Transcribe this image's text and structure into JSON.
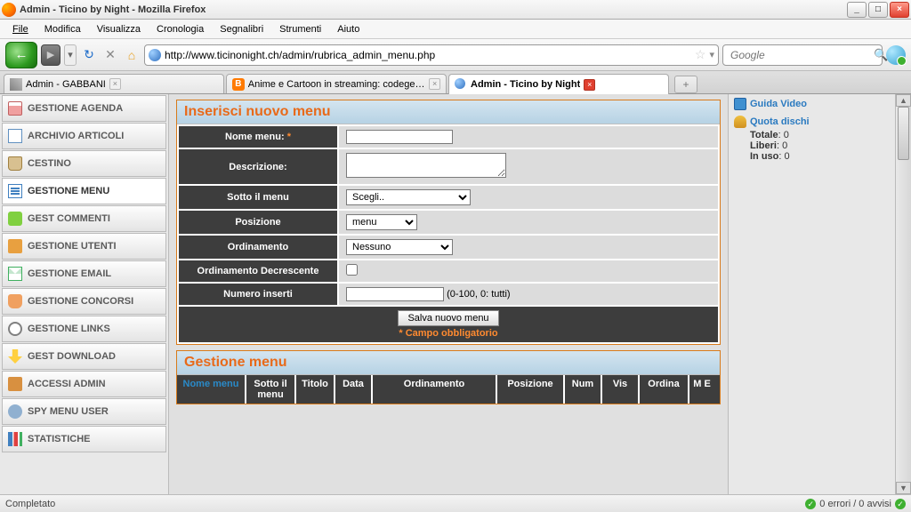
{
  "window": {
    "title": "Admin - Ticino by Night - Mozilla Firefox",
    "min": "_",
    "max": "□",
    "close": "×"
  },
  "menubar": [
    "File",
    "Modifica",
    "Visualizza",
    "Cronologia",
    "Segnalibri",
    "Strumenti",
    "Aiuto"
  ],
  "navbar": {
    "url": "http://www.ticinonight.ch/admin/rubrica_admin_menu.php",
    "search_placeholder": "Google"
  },
  "tabs": [
    {
      "label": "Admin - GABBANI",
      "active": false,
      "icon": "key"
    },
    {
      "label": "Anime e Cartoon in streaming: codegea...",
      "active": false,
      "icon": "blog"
    },
    {
      "label": "Admin - Ticino by Night",
      "active": true,
      "icon": "globe"
    }
  ],
  "sidebar": [
    {
      "label": "GESTIONE AGENDA",
      "icon": "ic-cal"
    },
    {
      "label": "ARCHIVIO ARTICOLI",
      "icon": "ic-doc"
    },
    {
      "label": "CESTINO",
      "icon": "ic-trash"
    },
    {
      "label": "GESTIONE MENU",
      "icon": "ic-menu",
      "active": true
    },
    {
      "label": "GEST COMMENTI",
      "icon": "ic-chat"
    },
    {
      "label": "GESTIONE UTENTI",
      "icon": "ic-users"
    },
    {
      "label": "GESTIONE EMAIL",
      "icon": "ic-mail"
    },
    {
      "label": "GESTIONE CONCORSI",
      "icon": "ic-trophy"
    },
    {
      "label": "GESTIONE LINKS",
      "icon": "ic-link"
    },
    {
      "label": "GEST DOWNLOAD",
      "icon": "ic-dl"
    },
    {
      "label": "ACCESSI ADMIN",
      "icon": "ic-key"
    },
    {
      "label": "SPY MENU USER",
      "icon": "ic-spy"
    },
    {
      "label": "STATISTICHE",
      "icon": "ic-stats"
    }
  ],
  "form": {
    "panel_title": "Inserisci nuovo menu",
    "rows": {
      "nome": {
        "label": "Nome menu:",
        "required": true
      },
      "desc": {
        "label": "Descrizione:"
      },
      "sotto": {
        "label": "Sotto il menu",
        "value": "Scegli.."
      },
      "pos": {
        "label": "Posizione",
        "value": "menu"
      },
      "ord": {
        "label": "Ordinamento",
        "value": "Nessuno"
      },
      "orddesc": {
        "label": "Ordinamento Decrescente"
      },
      "num": {
        "label": "Numero inserti",
        "hint": "(0-100, 0: tutti)"
      }
    },
    "submit": "Salva nuovo menu",
    "required_note": "* Campo obbligatorio"
  },
  "grid": {
    "panel_title": "Gestione menu",
    "headers": [
      "Nome menu",
      "Sotto il menu",
      "Titolo",
      "Data",
      "Ordinamento",
      "Posizione",
      "Num",
      "Vis",
      "Ordina",
      "M E"
    ]
  },
  "rightbar": {
    "guida": "Guida Video",
    "quota_title": "Quota dischi",
    "quota": {
      "Totale": "0",
      "Liberi": "0",
      "In uso": "0"
    }
  },
  "statusbar": {
    "left": "Completato",
    "right": "0 errori / 0 avvisi"
  }
}
